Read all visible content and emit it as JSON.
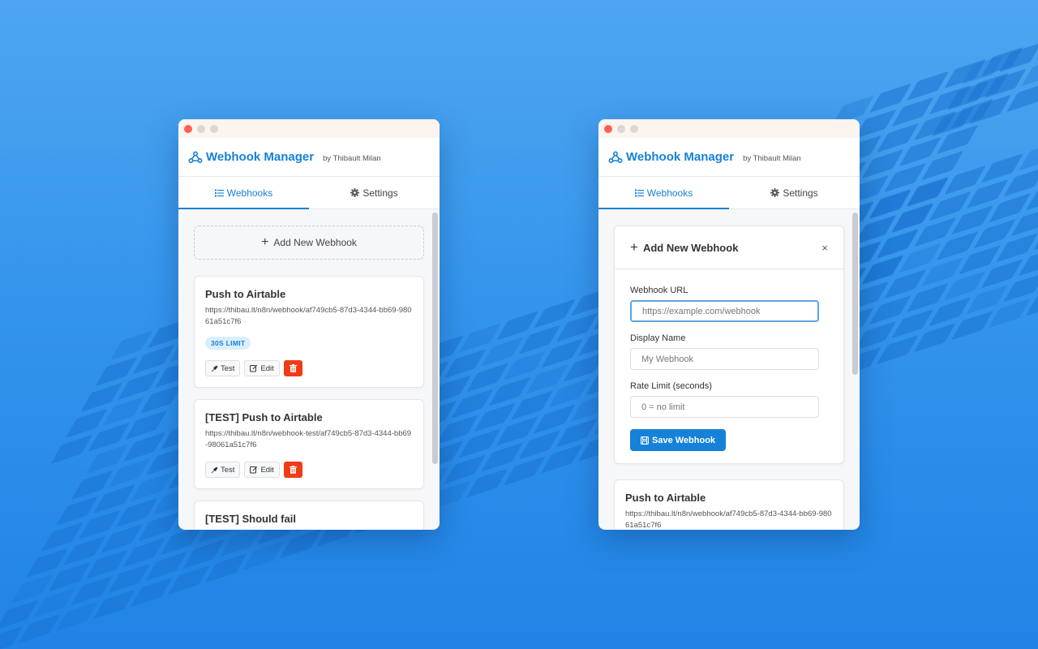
{
  "app": {
    "title": "Webhook Manager",
    "byline": "by Thibault Milan",
    "accent_color": "#1681d8",
    "danger_color": "#ef3b16"
  },
  "tabs": [
    {
      "label": "Webhooks",
      "icon": "list-icon",
      "active": true
    },
    {
      "label": "Settings",
      "icon": "gear-icon",
      "active": false
    }
  ],
  "left_window": {
    "add_button_label": "Add New Webhook",
    "webhooks": [
      {
        "name": "Push to Airtable",
        "url": "https://thibau.lt/n8n/webhook/af749cb5-87d3-4344-bb69-98061a51c7f6",
        "badge": "30S LIMIT"
      },
      {
        "name": "[TEST] Push to Airtable",
        "url": "https://thibau.lt/n8n/webhook-test/af749cb5-87d3-4344-bb69-98061a51c7f6",
        "badge": ""
      },
      {
        "name": "[TEST] Should fail",
        "url": "",
        "badge": ""
      }
    ],
    "actions": {
      "test_label": "Test",
      "edit_label": "Edit"
    }
  },
  "right_window": {
    "form": {
      "title": "Add New Webhook",
      "close_symbol": "×",
      "url_label": "Webhook URL",
      "url_placeholder": "https://example.com/webhook",
      "name_label": "Display Name",
      "name_placeholder": "My Webhook",
      "rate_label": "Rate Limit (seconds)",
      "rate_placeholder": "0 = no limit",
      "save_label": "Save Webhook"
    },
    "preview_webhook": {
      "name": "Push to Airtable",
      "url": "https://thibau.lt/n8n/webhook/af749cb5-87d3-4344-bb69-98061a51c7f6"
    }
  }
}
